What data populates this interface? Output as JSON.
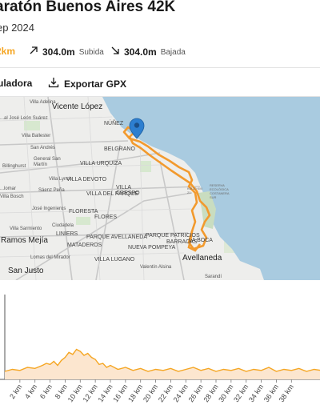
{
  "header": {
    "title": "aratón Buenos Aires 42K",
    "subtitle": "ep 2024"
  },
  "stats": {
    "distance": "2km",
    "ascent_value": "304.0m",
    "ascent_label": "Subida",
    "descent_value": "304.0m",
    "descent_label": "Bajada"
  },
  "actions": {
    "calculator_label": "uladora",
    "export_label": "Exportar GPX"
  },
  "colors": {
    "accent": "#f5a623",
    "route": "#f29a2e",
    "water": "#a9cbe0",
    "marker": "#2d7fd0"
  },
  "map": {
    "labels": {
      "villa_adelina": "Villa Adelina",
      "vicente_lopez": "Vicente López",
      "leon_suarez": "...al José León Suárez",
      "san_martin": "San Martín",
      "villa_ballester": "Villa Ballester",
      "san_andres": "San Andrés",
      "villa_ldiko": "Villa Lynch",
      "general_san_martin": "General San Martín",
      "saenz_pena": "Sáenz Peña",
      "billinghurst": "Billinghurst",
      "palomar": "...lomar",
      "villa_lynch": "Villa Lynch",
      "villa_bosch": "Villa Bosch",
      "jose_ingenieros": "José Ingenieros",
      "villa_sarmiento": "Villa Sarmiento",
      "ciudadela": "Ciudadela",
      "ramos_mejia": "Ramos Mejía",
      "lomas_del_mirador": "Lomas del Mirador",
      "san_justo": "San Justo",
      "valentin_alsina": "Valentín Alsina",
      "avellaneda": "Avellaneda",
      "sarandi": "Sarandí",
      "belgrano": "BELGRANO",
      "nunez": "NÚÑEZ",
      "villa_urquiza": "VILLA URQUIZA",
      "villa_crespo": "VILLA CRESPO",
      "flores": "FLORES",
      "liniers": "LINIERS",
      "villa_lugano": "VILLA LUGANO",
      "nueva_pompeya": "NUEVA POMPEYA",
      "floresta": "FLORESTA",
      "mataderos": "MATADEROS",
      "parque_avellaneda": "PARQUE AVELLANEDA",
      "villa_devoto": "VILLA DEVOTO",
      "villa_del_parque": "VILLA DEL PARQUE",
      "parque_patricios": "PARQUE PATRICIOS",
      "barracas": "BARRACAS",
      "boca": "LA BOCA",
      "reserva": "RESERVA ECOLÓGICA COSTANERA SUR",
      "km_marks": "KM 20 KM 21"
    }
  },
  "chart_data": {
    "type": "area",
    "x_unit": "km",
    "x_tick_labels": [
      "2 km",
      "4 km",
      "6 km",
      "8 km",
      "10 km",
      "12 km",
      "14 km",
      "16 km",
      "18 km",
      "20 km",
      "22 km",
      "24 km",
      "26 km",
      "28 km",
      "30 km",
      "32 km",
      "34 km",
      "36 km",
      "38 km"
    ],
    "x": [
      0,
      1,
      2,
      3,
      4,
      5,
      5.5,
      6,
      6.5,
      7,
      7.5,
      8,
      8.5,
      9,
      9.5,
      10,
      10.5,
      11,
      11.5,
      12,
      12.5,
      13,
      13.5,
      14,
      15,
      16,
      17,
      18,
      19,
      20,
      21,
      22,
      23,
      24,
      25,
      26,
      27,
      28,
      29,
      30,
      31,
      32,
      33,
      34,
      35,
      36,
      37,
      38,
      39,
      40,
      41,
      42
    ],
    "values": [
      8,
      10,
      9,
      12,
      11,
      14,
      16,
      15,
      18,
      14,
      19,
      22,
      27,
      25,
      30,
      28,
      24,
      26,
      22,
      20,
      15,
      16,
      12,
      14,
      10,
      12,
      9,
      11,
      8,
      10,
      9,
      11,
      8,
      10,
      12,
      9,
      11,
      8,
      10,
      9,
      11,
      8,
      10,
      9,
      12,
      8,
      10,
      9,
      11,
      8,
      10,
      9
    ],
    "ylim": [
      0,
      80
    ]
  }
}
